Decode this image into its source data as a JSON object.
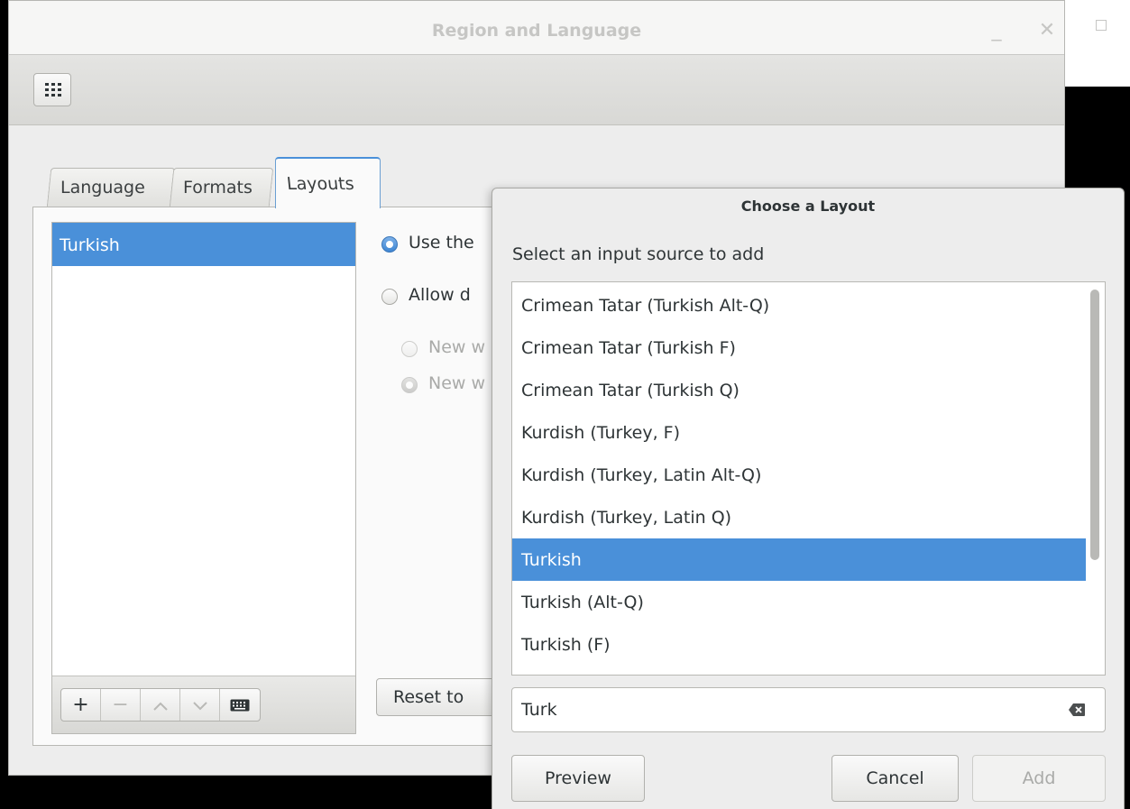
{
  "window": {
    "title": "Region and Language",
    "minimize": "_",
    "close": "✕"
  },
  "tabs": [
    {
      "label": "Language"
    },
    {
      "label": "Formats"
    },
    {
      "label": "Layouts",
      "active": true
    }
  ],
  "layouts_panel": {
    "input_sources": [
      "Turkish"
    ],
    "options": [
      {
        "label": "Use the",
        "checked": true,
        "enabled": true
      },
      {
        "label": "Allow d",
        "checked": false,
        "enabled": true
      },
      {
        "label": "New w",
        "checked": false,
        "enabled": false
      },
      {
        "label": "New w",
        "checked": true,
        "enabled": false
      }
    ],
    "toolbar": {
      "add": "+",
      "remove": "−",
      "up": "⌃",
      "down": "⌄"
    },
    "reset_label": "Reset to"
  },
  "dialog": {
    "title": "Choose a Layout",
    "subtitle": "Select an input source to add",
    "items": [
      "Crimean Tatar (Turkish Alt-Q)",
      "Crimean Tatar (Turkish F)",
      "Crimean Tatar (Turkish Q)",
      "Kurdish (Turkey, F)",
      "Kurdish (Turkey, Latin Alt-Q)",
      "Kurdish (Turkey, Latin Q)",
      "Turkish",
      "Turkish (Alt-Q)",
      "Turkish (F)"
    ],
    "selected_index": 6,
    "search_value": "Turk",
    "preview_label": "Preview",
    "cancel_label": "Cancel",
    "add_label": "Add"
  },
  "colors": {
    "selection": "#4a90d9",
    "window_bg": "#ededed",
    "text": "#2e3436"
  }
}
